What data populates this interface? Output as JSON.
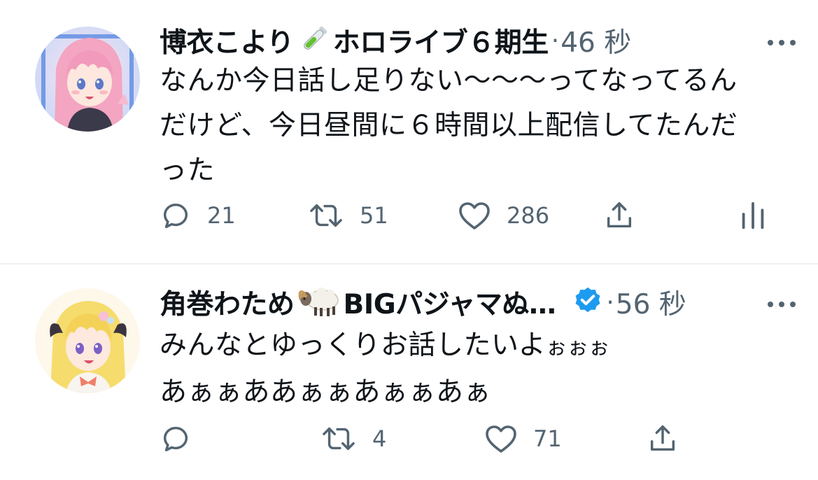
{
  "tweets": [
    {
      "display_name": "博衣こより",
      "name_suffix": "ホロライブ６期生",
      "separator": "·",
      "time": "46 秒",
      "text_lines": [
        "なんか今日話し足りない〜〜〜ってなってるん",
        "だけど、今日昼間に６時間以上配信してたんだ",
        "った"
      ],
      "replies": "21",
      "retweets": "51",
      "likes": "286"
    },
    {
      "display_name": "角巻わため",
      "name_suffix": "BIGパジャマぬ…",
      "separator": "·",
      "time": "56 秒",
      "text_line1_main": "みんなとゆっくりお話したいよ",
      "text_line1_small": "ぉぉぉ",
      "text_line2": "あぁぁああぁぁあぁぁあぁ",
      "replies": "",
      "retweets": "4",
      "likes": "71"
    }
  ],
  "icons": {
    "flask": "test-tube-emoji",
    "sheep": "ram-emoji",
    "verified": "verified-badge",
    "more": "more-dots",
    "reply": "reply-icon",
    "retweet": "retweet-icon",
    "like": "heart-icon",
    "share": "share-icon",
    "analytics": "analytics-icon"
  },
  "colors": {
    "text": "#0f1419",
    "secondary": "#536471",
    "verified": "#1d9bf0",
    "divider": "#eff3f4"
  }
}
